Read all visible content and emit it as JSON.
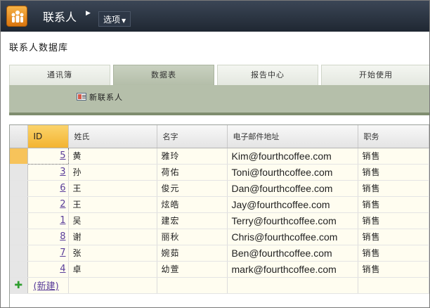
{
  "app": {
    "title": "联系人",
    "options_label": "选项",
    "logo_icon": "people-group-icon"
  },
  "page": {
    "title": "联系人数据库"
  },
  "tabs": [
    {
      "label": "通讯簿",
      "active": false
    },
    {
      "label": "数据表",
      "active": true
    },
    {
      "label": "报告中心",
      "active": false
    },
    {
      "label": "开始使用",
      "active": false
    }
  ],
  "ribbon": {
    "new_contact_label": "新联系人",
    "new_contact_icon": "contact-card-icon"
  },
  "table": {
    "columns": [
      "ID",
      "姓氏",
      "名字",
      "电子邮件地址",
      "职务"
    ],
    "rows": [
      {
        "id": "5",
        "last": "黄",
        "first": "雅玲",
        "email": "Kim@fourthcoffee.com",
        "title": "销售"
      },
      {
        "id": "3",
        "last": "孙",
        "first": "荷佑",
        "email": "Toni@fourthcoffee.com",
        "title": "销售"
      },
      {
        "id": "6",
        "last": "王",
        "first": "俊元",
        "email": "Dan@fourthcoffee.com",
        "title": "销售"
      },
      {
        "id": "2",
        "last": "王",
        "first": "炫皓",
        "email": "Jay@fourthcoffee.com",
        "title": "销售"
      },
      {
        "id": "1",
        "last": "吴",
        "first": "建宏",
        "email": "Terry@fourthcoffee.com",
        "title": "销售"
      },
      {
        "id": "8",
        "last": "谢",
        "first": "丽秋",
        "email": "Chris@fourthcoffee.com",
        "title": "销售"
      },
      {
        "id": "7",
        "last": "张",
        "first": "婉茹",
        "email": "Ben@fourthcoffee.com",
        "title": "销售"
      },
      {
        "id": "4",
        "last": "卓",
        "first": "幼萱",
        "email": "mark@fourthcoffee.com",
        "title": "销售"
      }
    ],
    "new_row_label": "(新建)",
    "new_row_icon": "plus-icon"
  },
  "colors": {
    "topbar": "#2a3340",
    "ribbon": "#b5bfaa",
    "id_header": "#f3b431",
    "link": "#5a3d9a"
  }
}
